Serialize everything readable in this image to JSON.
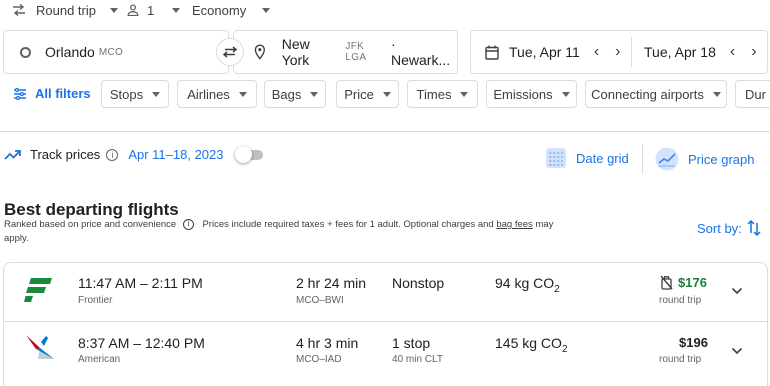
{
  "top_options": {
    "trip_type": "Round trip",
    "passengers": "1",
    "cabin": "Economy"
  },
  "search": {
    "origin_city": "Orlando",
    "origin_code": "MCO",
    "destination_city": "New York",
    "destination_codes": "JFK LGA",
    "destination_more": "· Newark...",
    "depart_date": "Tue, Apr 11",
    "return_date": "Tue, Apr 18"
  },
  "filters": {
    "all_filters": "All filters",
    "chips": [
      "Stops",
      "Airlines",
      "Bags",
      "Price",
      "Times",
      "Emissions",
      "Connecting airports",
      "Dur"
    ]
  },
  "track": {
    "label": "Track prices",
    "dates": "Apr 11–18, 2023",
    "date_grid": "Date grid",
    "price_graph": "Price graph"
  },
  "results": {
    "heading": "Best departing flights",
    "ranked_note": "Ranked based on price and convenience",
    "prices_note_prefix": "Prices include required taxes + fees for 1 adult. Optional charges and ",
    "bag_fees_link": "bag fees",
    "prices_note_suffix": " may",
    "prices_note_wrap": "apply.",
    "sort_by": "Sort by:"
  },
  "flights": [
    {
      "times": "11:47 AM – 2:11 PM",
      "airline": "Frontier",
      "duration": "2 hr 24 min",
      "route": "MCO–BWI",
      "stops": "Nonstop",
      "stops_detail": "",
      "emissions_value": "94 kg CO",
      "emissions_sub": "2",
      "price": "$176",
      "price_note": "round trip",
      "price_color": "#188038"
    },
    {
      "times": "8:37 AM – 12:40 PM",
      "airline": "American",
      "duration": "4 hr 3 min",
      "route": "MCO–IAD",
      "stops": "1 stop",
      "stops_detail": "40 min CLT",
      "emissions_value": "145 kg CO",
      "emissions_sub": "2",
      "price": "$196",
      "price_note": "round trip",
      "price_color": "#202124"
    }
  ],
  "colors": {
    "accent": "#1a73e8",
    "good_price": "#188038",
    "frontier_green": "#1a8a3a",
    "border": "#dadce0"
  }
}
